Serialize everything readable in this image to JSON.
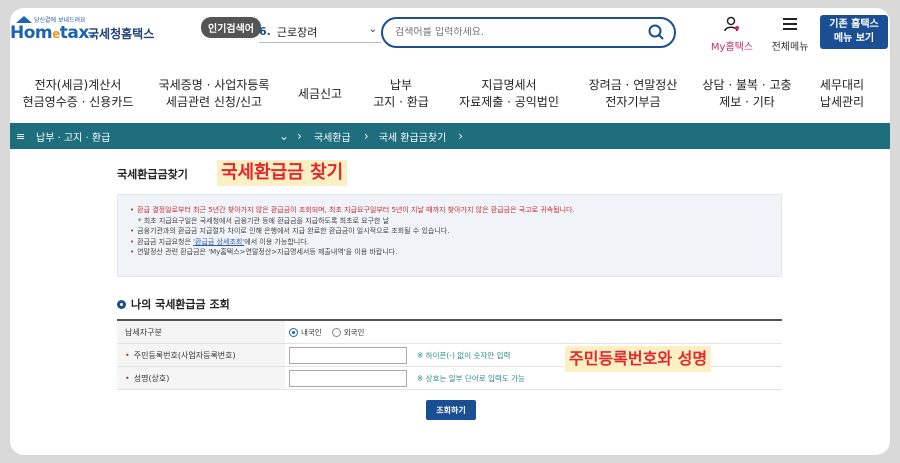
{
  "header": {
    "logo_tagline": "당신곁에 보내드려요",
    "logo_word_a": "Hom",
    "logo_word_e": "e",
    "logo_word_b": "tax.",
    "logo_name": "국세청홈택스",
    "popular_badge": "인기검색어",
    "popular_rank": "6.",
    "popular_term": "근로장려",
    "search_placeholder": "검색어를 입력하세요.",
    "my_hometax": "My홈택스",
    "all_menu": "전체메뉴",
    "basic_menu_line1": "기존 홈택스",
    "basic_menu_line2": "메뉴 보기"
  },
  "gnb": [
    {
      "line1": "전자(세금)계산서",
      "line2": "현금영수증 · 신용카드"
    },
    {
      "line1": "국세증명 · 사업자등록",
      "line2": "세금관련 신청/신고"
    },
    {
      "line1": "세금신고",
      "line2": ""
    },
    {
      "line1": "납부",
      "line2": "고지 · 환급"
    },
    {
      "line1": "지급명세서",
      "line2": "자료제출 · 공익법인"
    },
    {
      "line1": "장려금 · 연말정산",
      "line2": "전자기부금"
    },
    {
      "line1": "상담 · 불복 · 고충",
      "line2": "제보 · 기타"
    },
    {
      "line1": "세무대리",
      "line2": "납세관리"
    }
  ],
  "breadcrumb": {
    "level1": "납부 · 고지 · 환급",
    "level2": "국세환급",
    "level3": "국세 환급금찾기"
  },
  "page": {
    "title": "국세환급금찾기",
    "callout_title": "국세환급금 찾기",
    "callout_id": "주민등록번호와 성명"
  },
  "notice": {
    "item1": "환급 결정일로부터 최근 5년간 찾아가지 않은 환급금이 조회되며, 최초 지급요구일부터 5년이 지날 때까지 찾아가지 않은 환급금은 국고로 귀속됩니다.",
    "item1_sub": "최초 지급요구일은 국세청에서 금융기관 등에 환급금을 지급하도록 최초로 요구한 날",
    "item2": "금융기관과의 환급금 지급절차 차이로 인해 은행에서 지급 완료한 환급금이 일시적으로 조회될 수 있습니다.",
    "item3_pre": "환급금 지급요청은 ",
    "item3_link": "'환급금 상세조회'",
    "item3_post": "에서 이용 가능합니다.",
    "item4": "연말정산 관련 환급금은 'My홈택스>연말정산>지급명세서등 제출내역'을 이용 바랍니다."
  },
  "form": {
    "section_title": "나의 국세환급금 조회",
    "taxpayer_type_label": "납세자구분",
    "option_domestic": "내국인",
    "option_foreign": "외국인",
    "id_label": "주민등록번호(사업자등록번호)",
    "id_hint": "※ 하이픈(-) 없이 숫자만 입력",
    "name_label": "성명(상호)",
    "name_hint": "※ 상호는 일부 단어로 입력도 가능",
    "submit": "조회하기"
  },
  "colors": {
    "brand_navy": "#1b4f93",
    "breadcrumb_teal": "#1f6e7e",
    "callout_red": "#e5262f",
    "callout_bg": "#fbf0c4"
  }
}
